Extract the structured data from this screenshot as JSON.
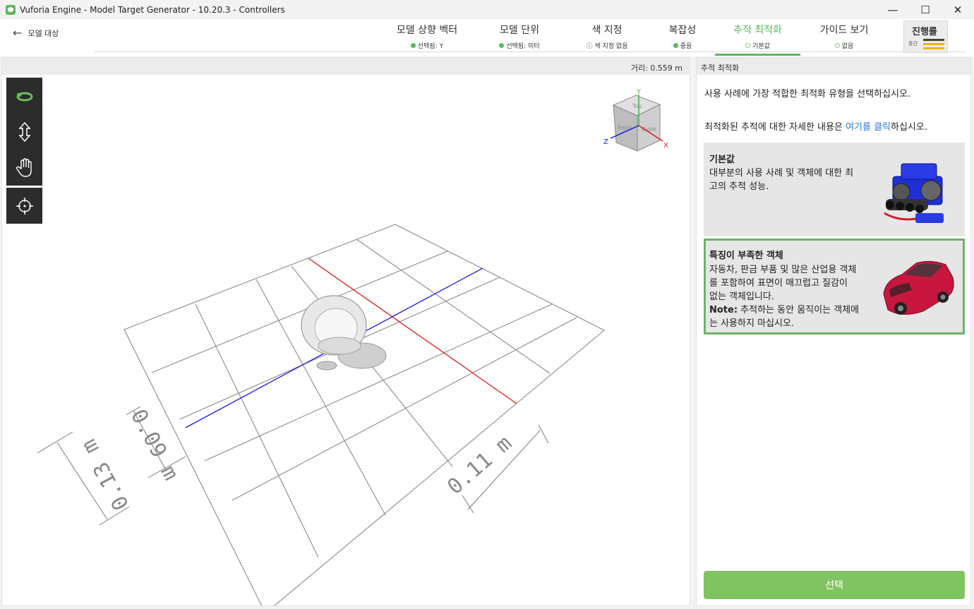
{
  "window": {
    "title": "Vuforia Engine - Model Target Generator - 10.20.3 - Controllers",
    "minimize": "—",
    "maximize": "☐",
    "close": "✕"
  },
  "header": {
    "back_label": "모델 대상",
    "steps": [
      {
        "title": "모델 상향 벡터",
        "status": "선택됨: Y",
        "state": "done"
      },
      {
        "title": "모델 단위",
        "status": "선택됨: 미터",
        "state": "done"
      },
      {
        "title": "색 지정",
        "status": "색 지정 없음",
        "state": "warning"
      },
      {
        "title": "복잡성",
        "status": "중음",
        "state": "done"
      },
      {
        "title": "추적 최적화",
        "status": "기본값",
        "state": "active"
      },
      {
        "title": "가이드 보기",
        "status": "없음",
        "state": "pending"
      }
    ],
    "progress": {
      "title": "진행률",
      "level": "중간"
    }
  },
  "viewport": {
    "distance": "거리: 0.559 m",
    "cube_labels": {
      "top": "Top",
      "right": "Right",
      "front": "Front"
    },
    "axis_labels": {
      "x": "X",
      "y": "Y",
      "z": "Z"
    },
    "dimensions": {
      "a": "0.09 m",
      "b": "0.13 m",
      "c": "0.11 m"
    }
  },
  "panel": {
    "header": "추적 최적화",
    "description": "사용 사례에 가장 적합한 최적화 유형을 선택하십시오.",
    "info_pre": "최적화된 추적에 대한 자세한 내용은 ",
    "info_link": "여기를 클릭",
    "info_post": "하십시오.",
    "options": [
      {
        "title": "기본값",
        "body_lines": [
          "대부분의 사용 사례 및 객체에 대한 최",
          "고의 추적 성능."
        ]
      },
      {
        "title": "특징이 부족한 객체",
        "body_lines": [
          "자동차, 판금 부품 및 많은 산업용 객체",
          "를 포함하여 표면이 매끄럽고 질감이",
          "없는 객체입니다."
        ],
        "note_label": "Note:",
        "note_text": " 추적하는 동안 움직이는 객체에",
        "note_line2": "는 사용하지 마십시오."
      }
    ],
    "select_button": "선택"
  },
  "colors": {
    "accent": "#5cb85c",
    "warning": "#dd2222",
    "button": "#80c462"
  }
}
